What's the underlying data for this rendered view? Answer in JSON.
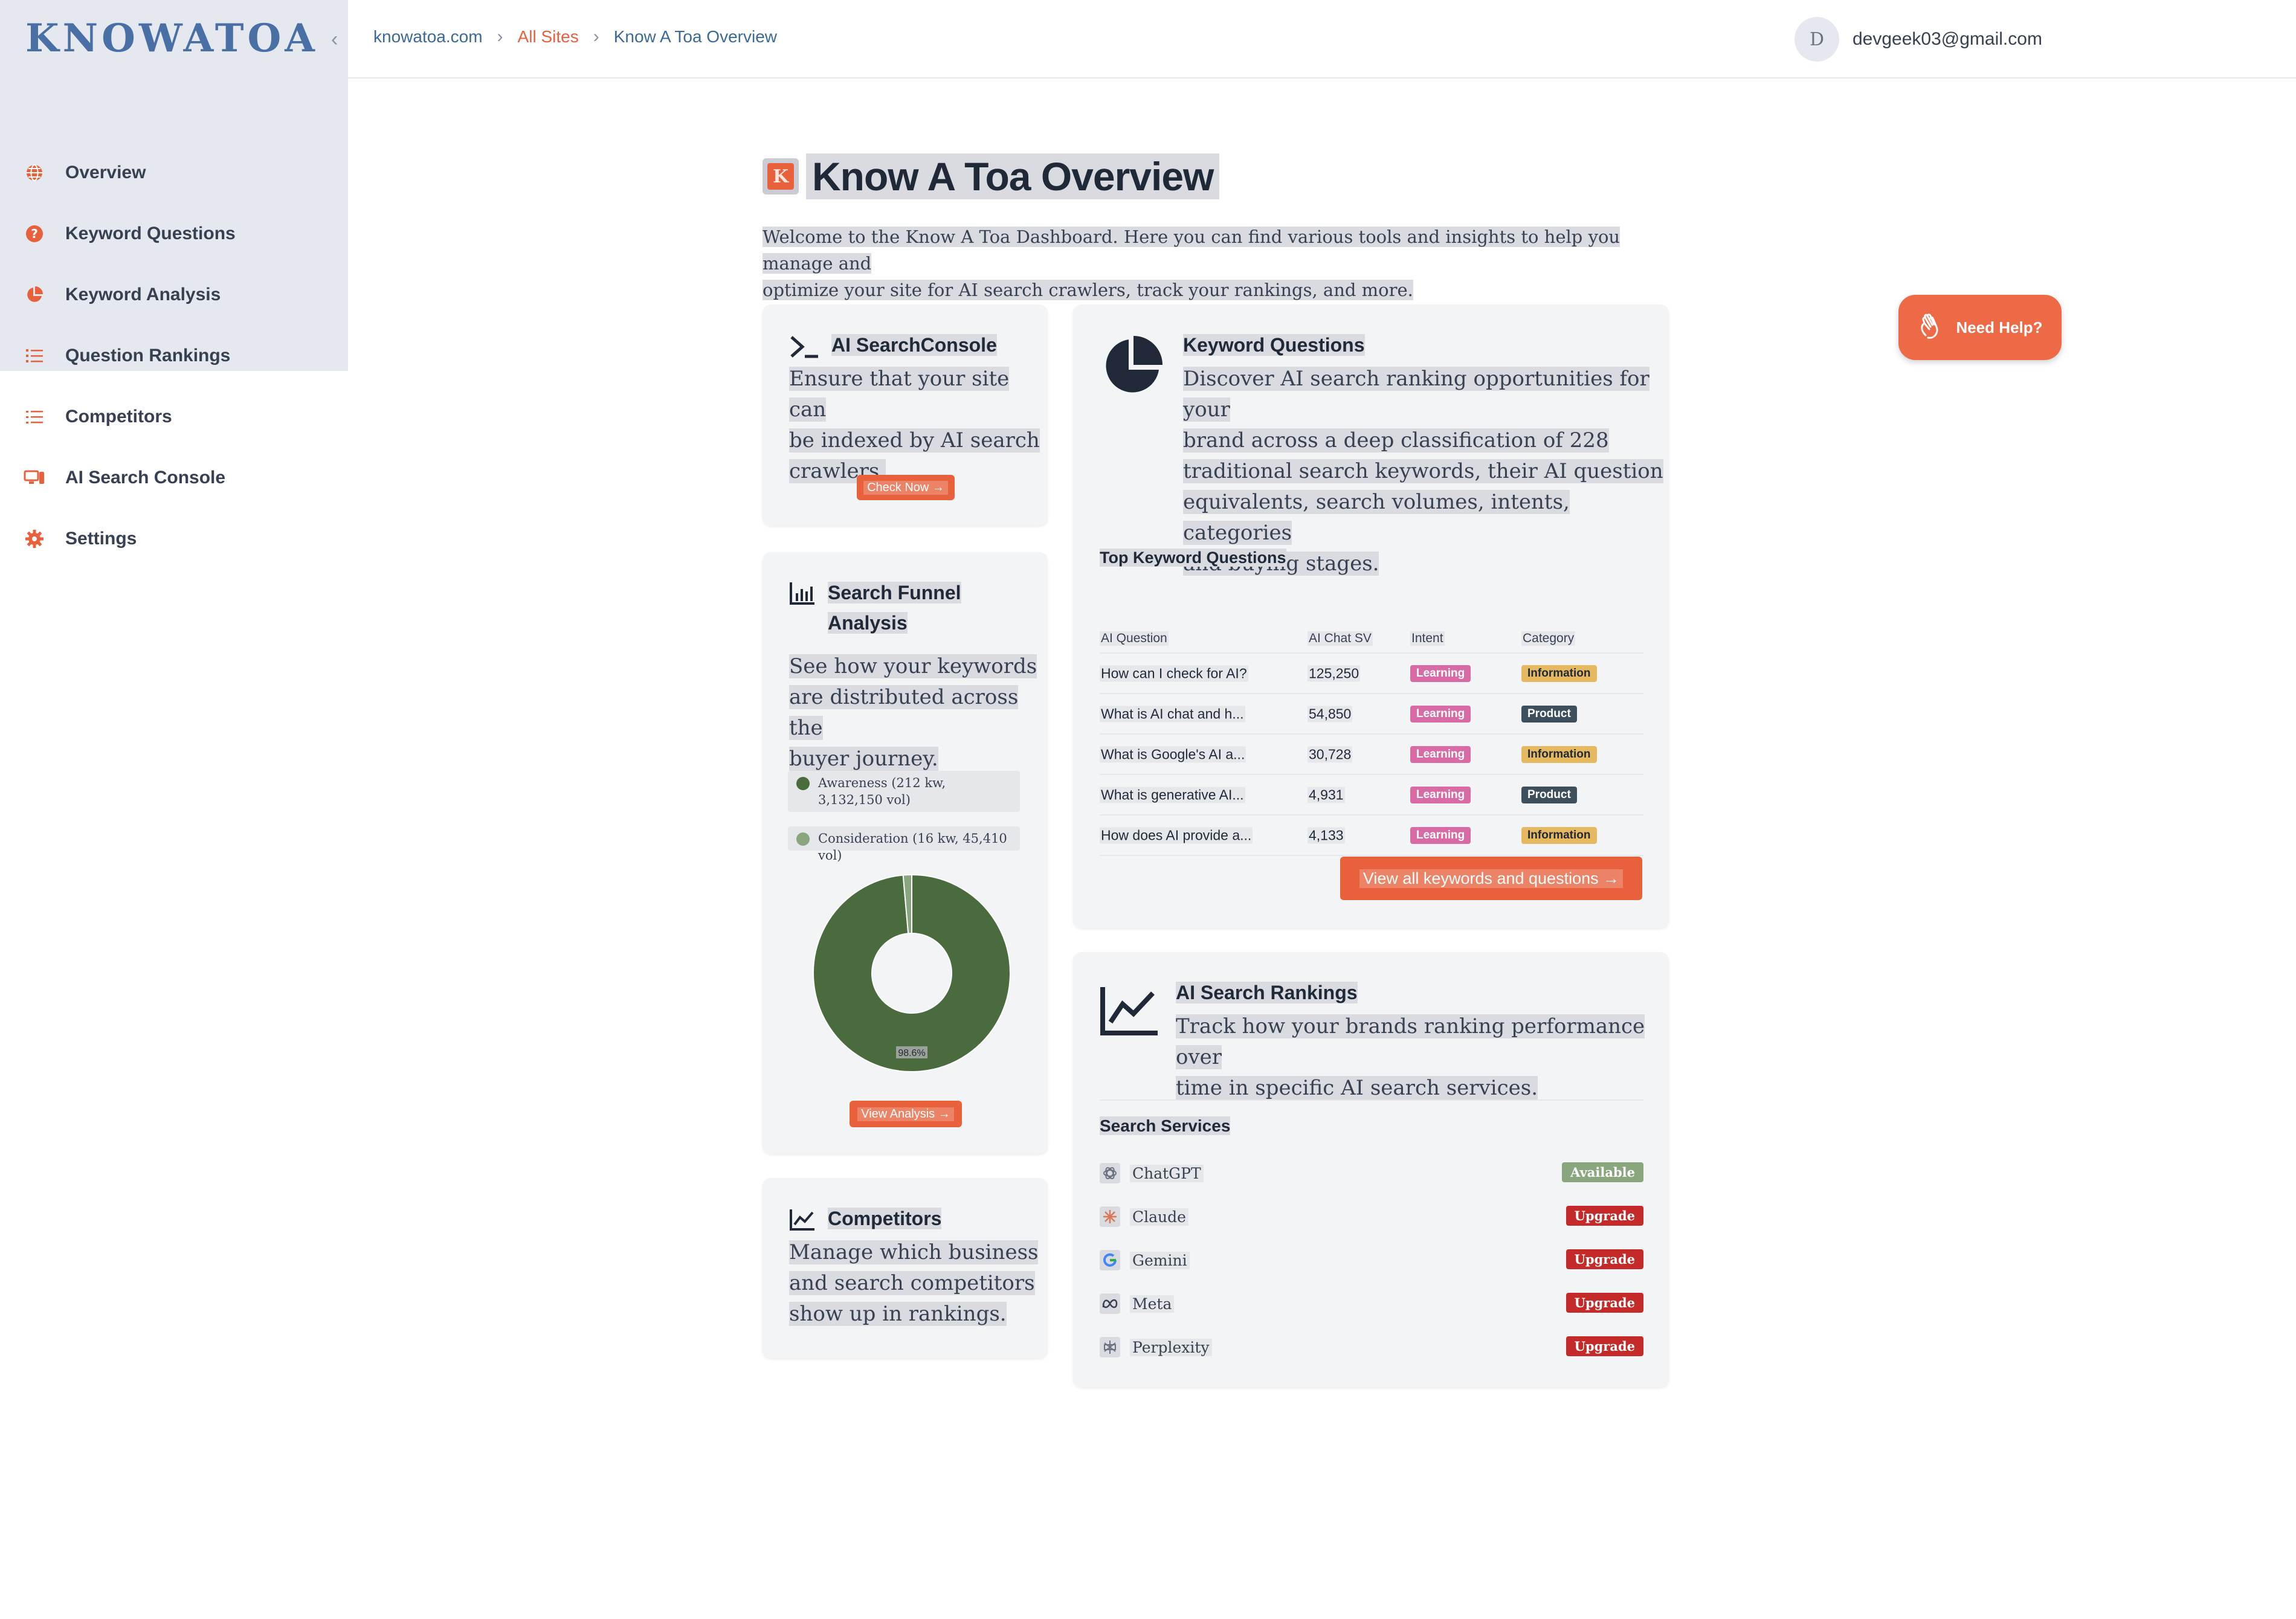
{
  "brand": "KNOWATOA",
  "sidebar": {
    "items": [
      {
        "label": "Overview",
        "icon": "globe-icon"
      },
      {
        "label": "Keyword Questions",
        "icon": "question-circle-icon"
      },
      {
        "label": "Keyword Analysis",
        "icon": "pie-chart-icon"
      },
      {
        "label": "Question Rankings",
        "icon": "list-ordered-icon"
      },
      {
        "label": "Competitors",
        "icon": "list-icon"
      },
      {
        "label": "AI Search Console",
        "icon": "devices-icon"
      },
      {
        "label": "Settings",
        "icon": "gear-icon"
      }
    ],
    "collapse_glyph": "‹"
  },
  "breadcrumb": {
    "items": [
      "knowatoa.com",
      "All Sites",
      "Know A Toa Overview"
    ],
    "sep": "›"
  },
  "user": {
    "initial": "D",
    "email": "devgeek03@gmail.com"
  },
  "page": {
    "title": "Know A Toa Overview",
    "logo_letter": "K",
    "intro_1": "Welcome to the Know A Toa Dashboard. Here you can find various tools and insights to help you manage and",
    "intro_2": "optimize your site for AI search crawlers, track your rankings, and more."
  },
  "cards": {
    "console": {
      "title": "AI SearchConsole",
      "text": [
        "Ensure that your site can",
        "be indexed by AI search",
        "crawlers."
      ],
      "button": "Check Now →"
    },
    "funnel": {
      "title": [
        "Search Funnel",
        "Analysis"
      ],
      "text": [
        "See how your keywords",
        "are distributed across the",
        "buyer journey."
      ],
      "legend": [
        {
          "label": "Awareness (212 kw, 3,132,150 vol)",
          "color": "#4a6b3d"
        },
        {
          "label": "Consideration (16 kw, 45,410 vol)",
          "color": "#8aa67e"
        }
      ],
      "button": "View Analysis →"
    },
    "competitors": {
      "title": "Competitors",
      "text": [
        "Manage which business",
        "and search competitors",
        "show up in rankings."
      ]
    },
    "keywords": {
      "title": "Keyword Questions",
      "text": [
        "Discover AI search ranking opportunities for your",
        "brand across a deep classification of 228",
        "traditional search keywords, their AI question",
        "equivalents, search volumes, intents, categories",
        "and buying stages."
      ],
      "table_title": "Top Keyword Questions",
      "columns": [
        "AI Question",
        "AI Chat SV",
        "Intent",
        "Category"
      ],
      "rows": [
        {
          "q": "How can I check for AI?",
          "sv": "125,250",
          "intent": "Learning",
          "cat": "Information"
        },
        {
          "q": "What is AI chat and h...",
          "sv": "54,850",
          "intent": "Learning",
          "cat": "Product"
        },
        {
          "q": "What is Google's AI a...",
          "sv": "30,728",
          "intent": "Learning",
          "cat": "Information"
        },
        {
          "q": "What is generative AI...",
          "sv": "4,931",
          "intent": "Learning",
          "cat": "Product"
        },
        {
          "q": "How does AI provide a...",
          "sv": "4,133",
          "intent": "Learning",
          "cat": "Information"
        }
      ],
      "button": "View all keywords and questions →"
    },
    "rankings": {
      "title": "AI Search Rankings",
      "text": [
        "Track how your brands ranking performance over",
        "time in specific AI search services."
      ],
      "services_title": "Search Services",
      "services": [
        {
          "name": "ChatGPT",
          "status": "Available",
          "icon": "chatgpt-icon"
        },
        {
          "name": "Claude",
          "status": "Upgrade",
          "icon": "claude-icon"
        },
        {
          "name": "Gemini",
          "status": "Upgrade",
          "icon": "google-icon"
        },
        {
          "name": "Meta",
          "status": "Upgrade",
          "icon": "meta-icon"
        },
        {
          "name": "Perplexity",
          "status": "Upgrade",
          "icon": "perplexity-icon"
        }
      ]
    }
  },
  "help": {
    "label": "Need Help?"
  },
  "chart_data": {
    "type": "pie",
    "categories": [
      "Awareness",
      "Consideration"
    ],
    "values": [
      98.6,
      1.4
    ],
    "colors": [
      "#4a6b3d",
      "#8aa67e"
    ],
    "data_labels": [
      "98.6%"
    ]
  }
}
